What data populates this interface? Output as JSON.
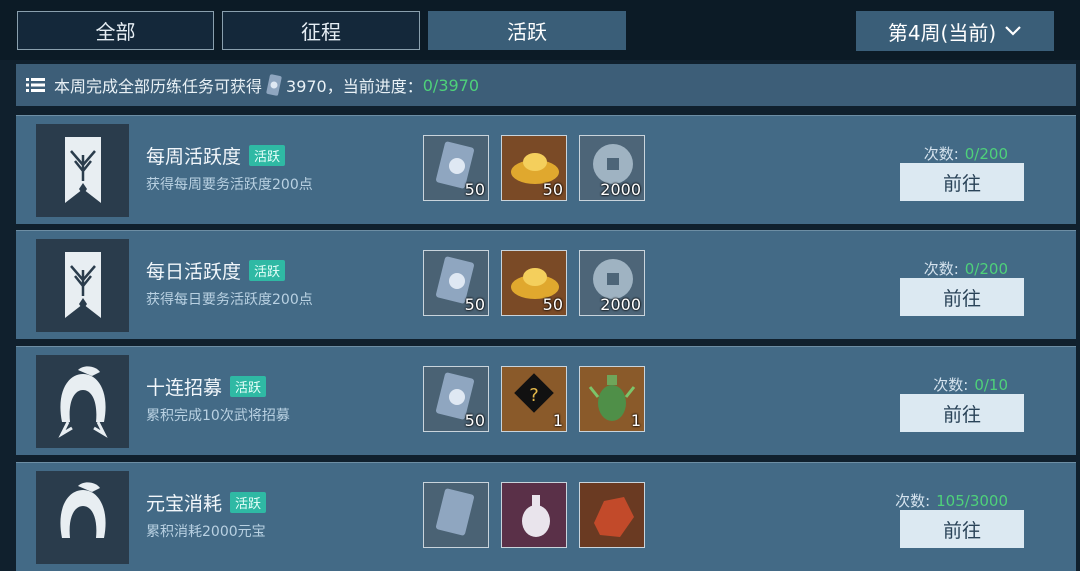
{
  "tabs": [
    {
      "label": "全部",
      "active": false
    },
    {
      "label": "征程",
      "active": false
    },
    {
      "label": "活跃",
      "active": true
    }
  ],
  "week_selector": {
    "label": "第4周(当前)",
    "icon": "chevron-down-icon"
  },
  "summary": {
    "prefix": "本周完成全部历练任务可获得",
    "amount": "3970，当前进度：",
    "progress": "0/3970"
  },
  "tasks": [
    {
      "title": "每周活跃度",
      "badge": "活跃",
      "desc": "获得每周要务活跃度200点",
      "emblem": "banner-emblem-icon",
      "rewards": [
        {
          "icon": "token-icon",
          "qty": "50"
        },
        {
          "icon": "gold-ingot-icon",
          "qty": "50"
        },
        {
          "icon": "coin-icon",
          "qty": "2000"
        }
      ],
      "count_label": "次数:",
      "count_value": "0/200",
      "button": "前往"
    },
    {
      "title": "每日活跃度",
      "badge": "活跃",
      "desc": "获得每日要务活跃度200点",
      "emblem": "banner-emblem-icon",
      "rewards": [
        {
          "icon": "token-icon",
          "qty": "50"
        },
        {
          "icon": "gold-ingot-icon",
          "qty": "50"
        },
        {
          "icon": "coin-icon",
          "qty": "2000"
        }
      ],
      "count_label": "次数:",
      "count_value": "0/200",
      "button": "前往"
    },
    {
      "title": "十连招募",
      "badge": "活跃",
      "desc": "累积完成10次武将招募",
      "emblem": "helmet-emblem-icon",
      "rewards": [
        {
          "icon": "token-icon",
          "qty": "50"
        },
        {
          "icon": "mystery-item-icon",
          "qty": "1"
        },
        {
          "icon": "jade-vase-icon",
          "qty": "1"
        }
      ],
      "count_label": "次数:",
      "count_value": "0/10",
      "button": "前往"
    },
    {
      "title": "元宝消耗",
      "badge": "活跃",
      "desc": "累积消耗2000元宝",
      "emblem": "helmet-emblem-icon",
      "rewards": [
        {
          "icon": "token-icon",
          "qty": ""
        },
        {
          "icon": "porcelain-vase-icon",
          "qty": ""
        },
        {
          "icon": "red-ore-icon",
          "qty": ""
        }
      ],
      "count_label": "次数:",
      "count_value": "105/3000",
      "button": "前往"
    }
  ]
}
